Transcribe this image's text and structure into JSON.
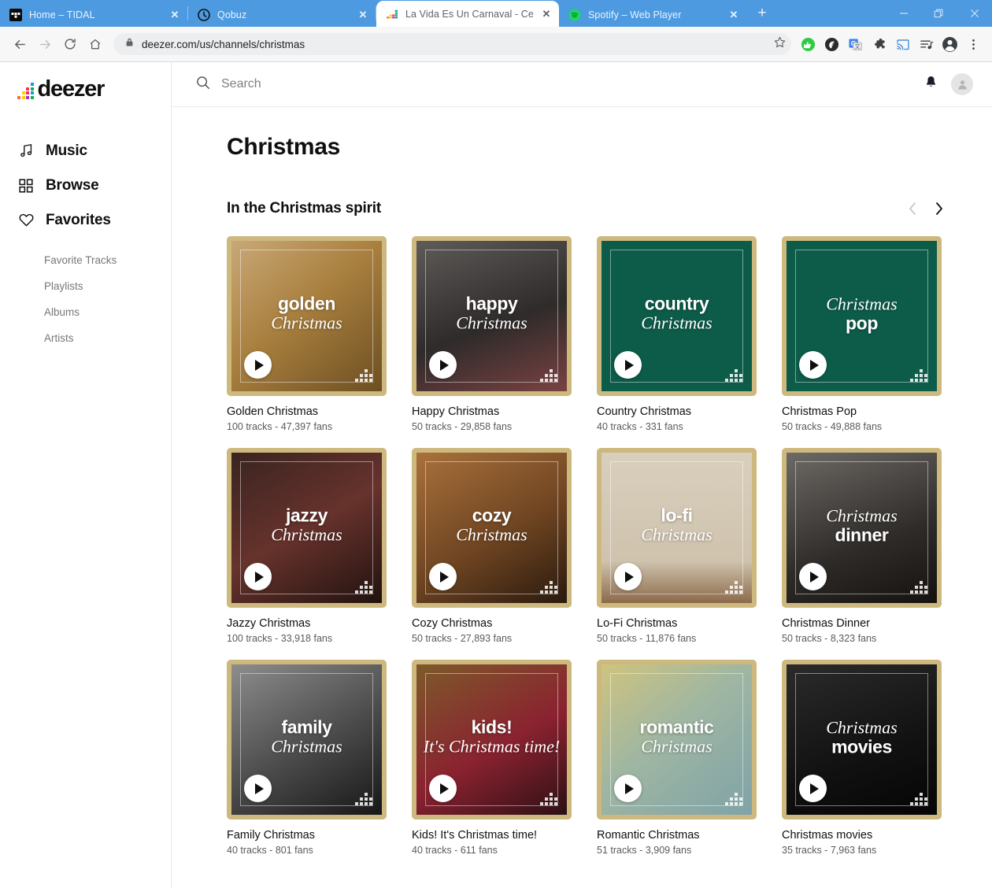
{
  "browser": {
    "tabs": [
      {
        "title": "Home – TIDAL",
        "favicon": "tidal-icon",
        "active": false,
        "close_label": "✕"
      },
      {
        "title": "Qobuz",
        "favicon": "qobuz-icon",
        "active": false,
        "close_label": "✕"
      },
      {
        "title": "La Vida Es Un Carnaval - Celia Cru",
        "favicon": "deezer-icon",
        "active": true,
        "close_label": "✕"
      },
      {
        "title": "Spotify – Web Player",
        "favicon": "spotify-icon",
        "active": false,
        "close_label": "✕"
      }
    ],
    "new_tab_label": "+",
    "window_controls": {
      "minimize": "—",
      "maximize": "❐",
      "close": "✕"
    },
    "toolbar": {
      "back_label": "←",
      "forward_label": "→",
      "reload_label": "⟳",
      "home_label": "⌂",
      "url": "deezer.com/us/channels/christmas",
      "bookmark_label": "☆",
      "extensions": [
        "adblock-icon",
        "ecosia-icon",
        "google-translate-icon",
        "puzzle-extensions-icon",
        "cast-icon",
        "playlist-icon",
        "profile-icon",
        "menu-kebab-icon"
      ]
    }
  },
  "sidebar": {
    "logo_text": "deezer",
    "nav": [
      {
        "label": "Music",
        "icon": "music-note-icon"
      },
      {
        "label": "Browse",
        "icon": "grid-icon"
      },
      {
        "label": "Favorites",
        "icon": "heart-icon"
      }
    ],
    "subnav": [
      {
        "label": "Favorite Tracks"
      },
      {
        "label": "Playlists"
      },
      {
        "label": "Albums"
      },
      {
        "label": "Artists"
      }
    ]
  },
  "topbar": {
    "search_placeholder": "Search",
    "search_value": "",
    "notifications_icon": "bell-icon",
    "avatar_icon": "user-avatar-icon"
  },
  "main": {
    "page_title": "Christmas",
    "section_title": "In the Christmas spirit",
    "carousel_prev": "‹",
    "carousel_next": "›",
    "cards": [
      {
        "title": "Golden Christmas",
        "meta": "100 tracks - 47,397 fans",
        "cover_line1": "golden",
        "cover_line2": "Christmas",
        "order": "word-first",
        "bg": "linear-gradient(140deg,#c9a878 0%,#a9803f 45%,#6d4f22 100%)"
      },
      {
        "title": "Happy Christmas",
        "meta": "50 tracks - 29,858 fans",
        "cover_line1": "happy",
        "cover_line2": "Christmas",
        "order": "word-first",
        "bg": "linear-gradient(160deg,#5e5b59 0%,#2e2b2a 55%,#7a4242 100%)"
      },
      {
        "title": "Country Christmas",
        "meta": "40 tracks - 331 fans",
        "cover_line1": "country",
        "cover_line2": "Christmas",
        "order": "word-first",
        "bg": "#0d5c4a"
      },
      {
        "title": "Christmas Pop",
        "meta": "50 tracks - 49,888 fans",
        "cover_line1": "pop",
        "cover_line2": "Christmas",
        "order": "script-first",
        "bg": "#0d5c4a"
      },
      {
        "title": "Jazzy Christmas",
        "meta": "100 tracks - 33,918 fans",
        "cover_line1": "jazzy",
        "cover_line2": "Christmas",
        "order": "word-first",
        "bg": "linear-gradient(150deg,#3a2420 0%,#67322c 50%,#21120f 100%)"
      },
      {
        "title": "Cozy Christmas",
        "meta": "50 tracks - 27,893 fans",
        "cover_line1": "cozy",
        "cover_line2": "Christmas",
        "order": "word-first",
        "bg": "linear-gradient(150deg,#a9713b 0%,#6f4522 55%,#2a1a0d 100%)"
      },
      {
        "title": "Lo-Fi Christmas",
        "meta": "50 tracks - 11,876 fans",
        "cover_line1": "lo-fi",
        "cover_line2": "Christmas",
        "order": "word-first",
        "bg": "linear-gradient(180deg,#d9cfbd 0%,#cfc3ae 72%,#8c6a4a 100%)"
      },
      {
        "title": "Christmas Dinner",
        "meta": "50 tracks - 8,323 fans",
        "cover_line1": "dinner",
        "cover_line2": "Christmas",
        "order": "script-first",
        "bg": "linear-gradient(160deg,#6d6a66 0%,#2e2b28 60%,#15120f 100%)"
      },
      {
        "title": "Family Christmas",
        "meta": "40 tracks - 801 fans",
        "cover_line1": "family",
        "cover_line2": "Christmas",
        "order": "word-first",
        "bg": "linear-gradient(150deg,#8d8d8d 0%,#4a4a4a 55%,#171717 100%)"
      },
      {
        "title": "Kids! It's Christmas time!",
        "meta": "40 tracks - 611 fans",
        "cover_line1": "kids!",
        "cover_line2": "It's Christmas time!",
        "order": "word-first",
        "bg": "linear-gradient(150deg,#7d5a2a 0%,#8a2230 55%,#2d1014 100%)"
      },
      {
        "title": "Romantic Christmas",
        "meta": "51 tracks - 3,909 fans",
        "cover_line1": "romantic",
        "cover_line2": "Christmas",
        "order": "word-first",
        "bg": "linear-gradient(140deg,#cfc47f 0%,#9fb6a2 45%,#7fa3a8 100%)"
      },
      {
        "title": "Christmas movies",
        "meta": "35 tracks - 7,963 fans",
        "cover_line1": "movies",
        "cover_line2": "Christmas",
        "order": "script-first",
        "bg": "linear-gradient(160deg,#2b2b2b 0%,#111111 60%,#050505 100%)"
      }
    ]
  },
  "colors": {
    "chrome_blue": "#4d9ae0",
    "card_border_gold": "#cdb87e",
    "deezer_black": "#0f0f0f",
    "muted_text": "#5a5a5a"
  }
}
